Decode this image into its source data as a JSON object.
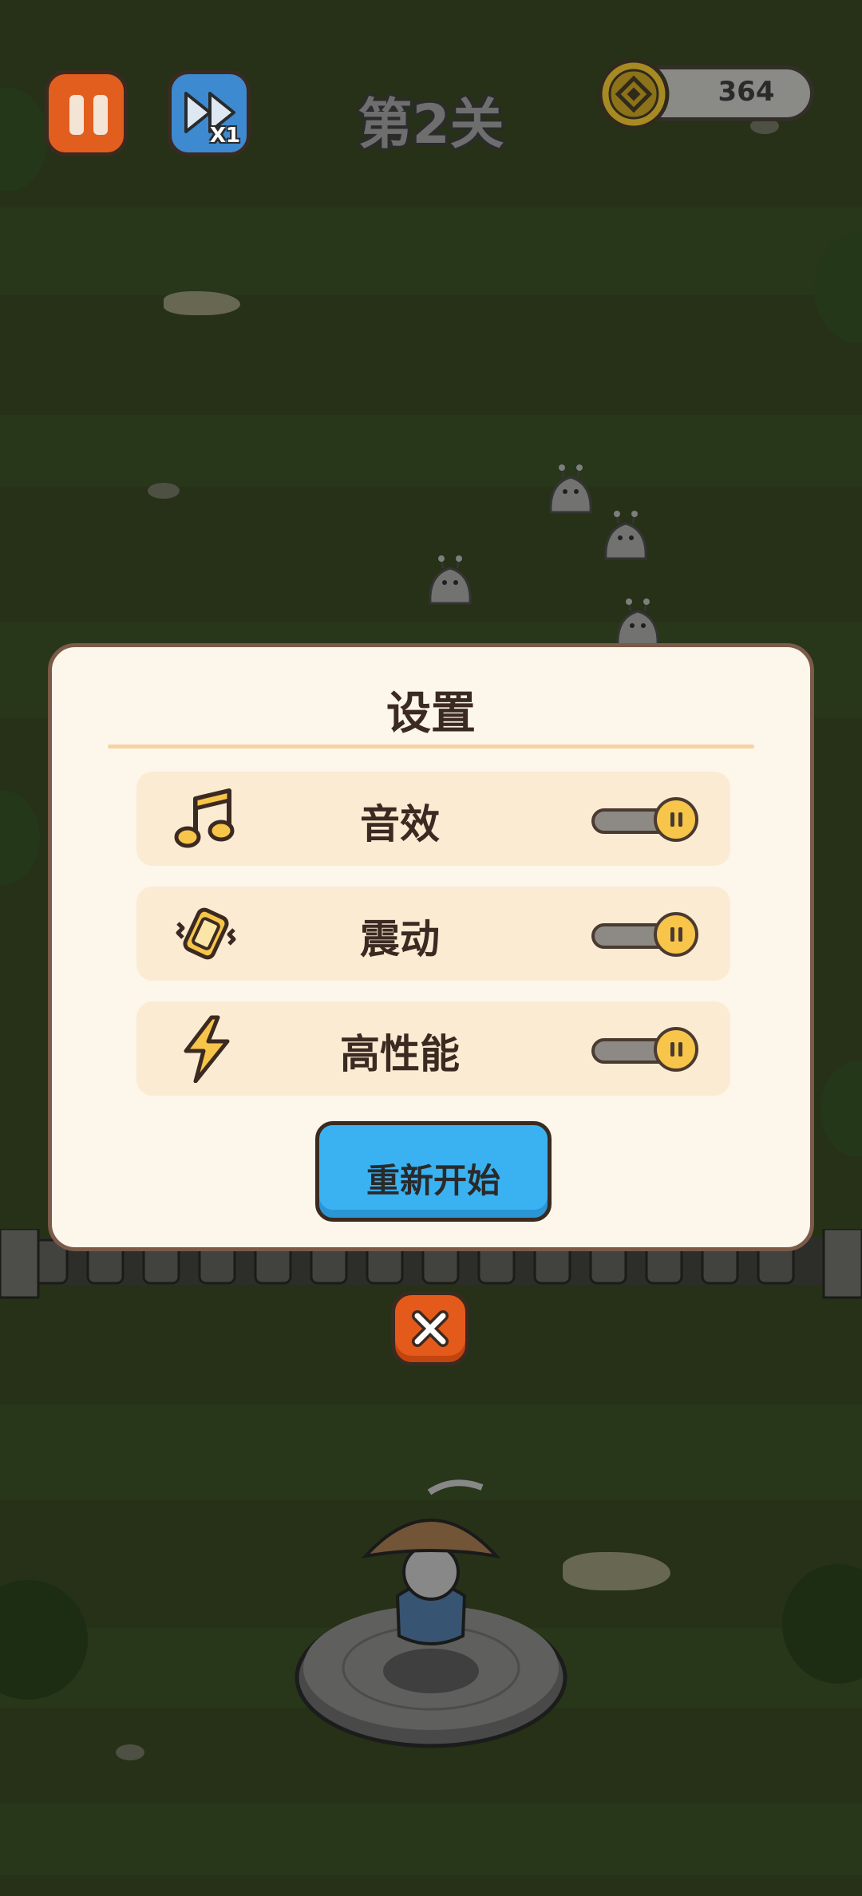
{
  "hud": {
    "speed_label": "X1",
    "level_title": "第2关",
    "coin_count": "364"
  },
  "settings": {
    "title": "设置",
    "rows": [
      {
        "label": "音效",
        "icon": "music-note-icon",
        "enabled": true
      },
      {
        "label": "震动",
        "icon": "vibration-icon",
        "enabled": true
      },
      {
        "label": "高性能",
        "icon": "lightning-icon",
        "enabled": true
      }
    ],
    "restart_label": "重新开始"
  },
  "colors": {
    "dialog_bg": "#fdf6ea",
    "row_bg": "#fbebd2",
    "toggle_knob": "#f7c54a",
    "restart_button": "#3ab2f2",
    "close_button": "#e45a1a",
    "pause_button": "#e25e1e",
    "speed_button": "#3d8ad0"
  }
}
